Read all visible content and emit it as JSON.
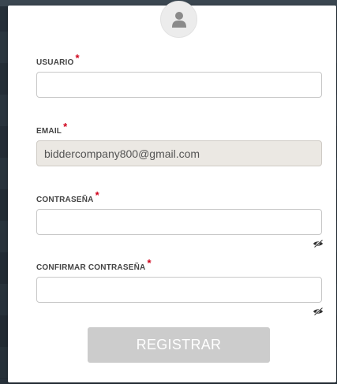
{
  "form": {
    "usuario": {
      "label": "USUARIO",
      "required_mark": "*",
      "value": "",
      "placeholder": ""
    },
    "email": {
      "label": "EMAIL",
      "required_mark": "*",
      "value": "biddercompany800@gmail.com"
    },
    "contrasena": {
      "label": "CONTRASEÑA",
      "required_mark": "*",
      "value": "",
      "placeholder": "",
      "toggle_icon": "eye-slash-icon"
    },
    "confirmar_contrasena": {
      "label": "CONFIRMAR CONTRASEÑA",
      "required_mark": "*",
      "value": "",
      "placeholder": "",
      "toggle_icon": "eye-slash-icon"
    },
    "submit_label": "REGISTRAR"
  },
  "avatar": {
    "icon": "user-icon"
  },
  "colors": {
    "required": "#d0021b",
    "button_disabled": "#cccccc",
    "readonly_bg": "#ebe8e3",
    "border": "#c8c8c8"
  }
}
